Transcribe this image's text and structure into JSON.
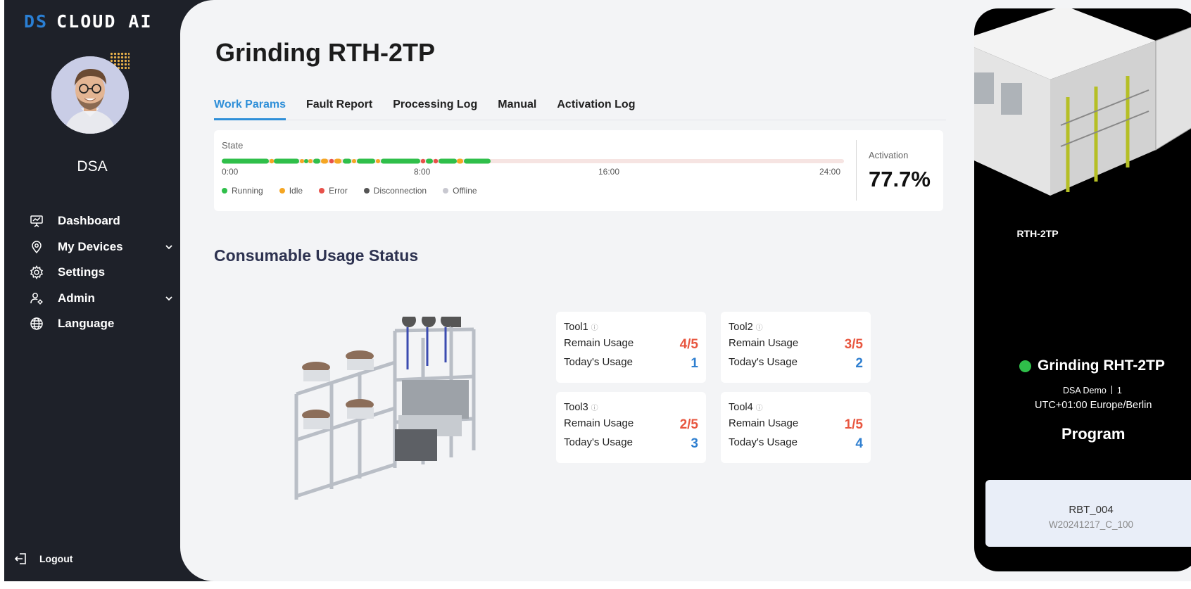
{
  "brand": {
    "prefix": "DS",
    "name": "CLOUD AI"
  },
  "user": {
    "name": "DSA"
  },
  "nav": {
    "items": [
      {
        "label": "Dashboard",
        "icon": "presentation-chart-icon"
      },
      {
        "label": "My Devices",
        "icon": "location-pin-icon",
        "expandable": true
      },
      {
        "label": "Settings",
        "icon": "gear-icon"
      },
      {
        "label": "Admin",
        "icon": "user-cog-icon",
        "expandable": true
      },
      {
        "label": "Language",
        "icon": "globe-icon"
      }
    ],
    "logout": "Logout"
  },
  "page": {
    "title": "Grinding RTH-2TP",
    "tabs": [
      "Work Params",
      "Fault Report",
      "Processing Log",
      "Manual",
      "Activation Log"
    ],
    "active_tab": "Work Params"
  },
  "state": {
    "label": "State",
    "ticks": [
      "0:00",
      "8:00",
      "16:00",
      "24:00"
    ],
    "legend": [
      {
        "label": "Running",
        "color": "#2fbf4a"
      },
      {
        "label": "Idle",
        "color": "#f5a623"
      },
      {
        "label": "Error",
        "color": "#e8514a"
      },
      {
        "label": "Disconnection",
        "color": "#555555"
      },
      {
        "label": "Offline",
        "color": "#c8c8d0"
      }
    ],
    "activation_label": "Activation",
    "activation_value": "77.7%"
  },
  "consumables": {
    "title": "Consumable Usage Status",
    "remain_label": "Remain Usage",
    "today_label": "Today's Usage",
    "tools": [
      {
        "name": "Tool1",
        "remain": "4/5",
        "today": "1"
      },
      {
        "name": "Tool2",
        "remain": "3/5",
        "today": "2"
      },
      {
        "name": "Tool3",
        "remain": "2/5",
        "today": "3"
      },
      {
        "name": "Tool4",
        "remain": "1/5",
        "today": "4"
      }
    ]
  },
  "device": {
    "code": "RTH-2TP",
    "status_name": "Grinding RHT-2TP",
    "status_color": "#2fbf4a",
    "org": "DSA Demo",
    "org_count": "1",
    "timezone": "UTC+01:00 Europe/Berlin",
    "program_title": "Program",
    "program_name": "RBT_004",
    "program_code": "W20241217_C_100"
  },
  "colors": {
    "accent": "#2f8fd8",
    "sidebar": "#1e2129",
    "remain": "#e8563f",
    "today": "#2f7fd0"
  }
}
